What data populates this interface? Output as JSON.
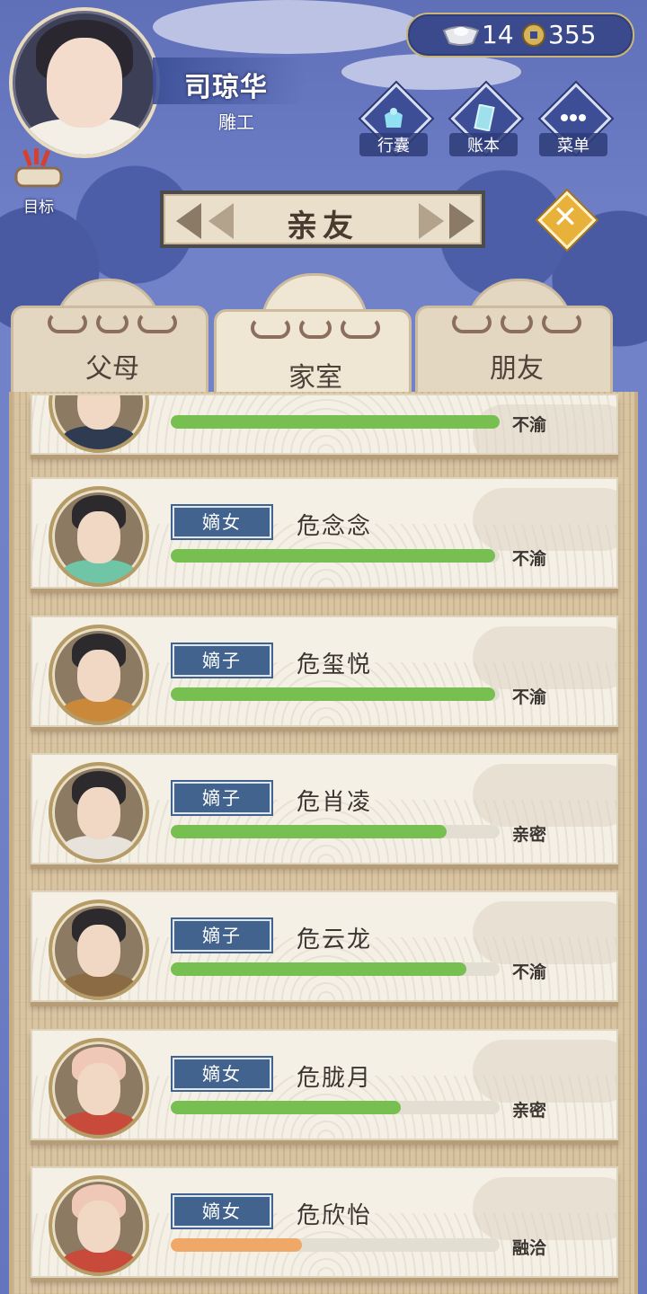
{
  "player": {
    "name": "司琼华",
    "title": "雕工"
  },
  "goal": {
    "label": "目标"
  },
  "currency": {
    "silver": "14",
    "coins": "355"
  },
  "menu": {
    "bag_label": "行囊",
    "ledger_label": "账本",
    "menu_label": "菜单"
  },
  "panel": {
    "title": "亲友"
  },
  "tabs": [
    {
      "label": "父母",
      "active": false
    },
    {
      "label": "家室",
      "active": true
    },
    {
      "label": "朋友",
      "active": false
    }
  ],
  "members": [
    {
      "role": "",
      "name": "",
      "relation": "不渝",
      "affinity": 1.0
    },
    {
      "role": "嫡女",
      "name": "危念念",
      "relation": "不渝",
      "affinity": 0.985
    },
    {
      "role": "嫡子",
      "name": "危玺悦",
      "relation": "不渝",
      "affinity": 0.985
    },
    {
      "role": "嫡子",
      "name": "危肖凌",
      "relation": "亲密",
      "affinity": 0.84
    },
    {
      "role": "嫡子",
      "name": "危云龙",
      "relation": "不渝",
      "affinity": 0.9
    },
    {
      "role": "嫡女",
      "name": "危胧月",
      "relation": "亲密",
      "affinity": 0.7
    },
    {
      "role": "嫡女",
      "name": "危欣怡",
      "relation": "融洽",
      "affinity": 0.4
    }
  ],
  "colors": {
    "bar_green": "#77bf50",
    "bar_orange": "#f0a868",
    "badge_blue": "#42638e"
  }
}
